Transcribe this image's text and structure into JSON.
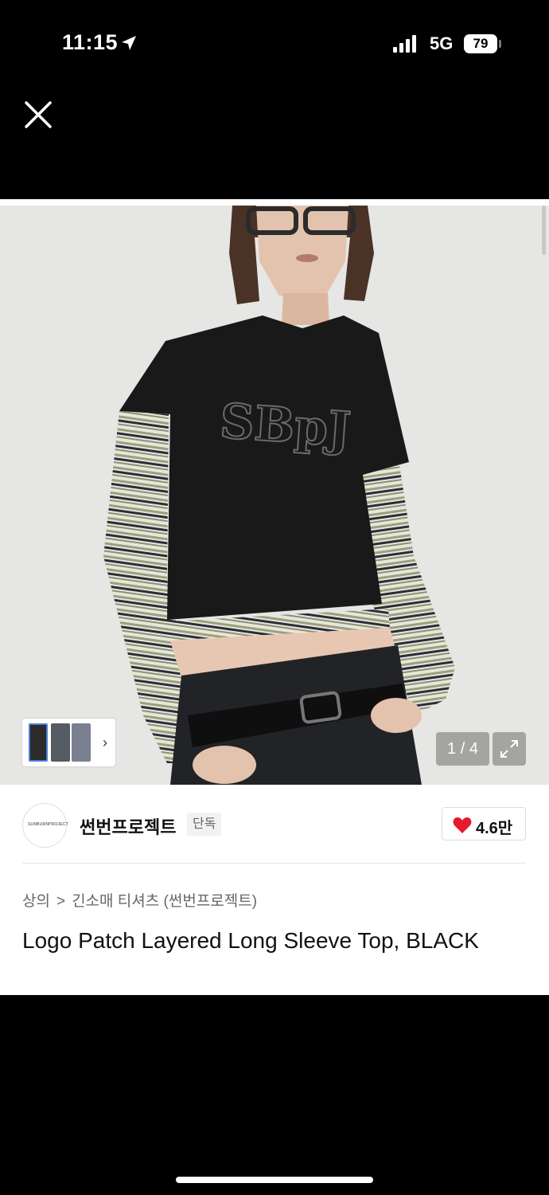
{
  "status_bar": {
    "time": "11:15",
    "network": "5G",
    "battery": "79"
  },
  "gallery": {
    "counter": "1 / 4",
    "thumb_chevron": "›"
  },
  "brand": {
    "logo_text": "SUNBURNPROJECT",
    "name": "썬번프로젝트",
    "badge": "단독",
    "likes": "4.6만"
  },
  "breadcrumb": {
    "category": "상의",
    "separator": ">",
    "subcategory": "긴소매 티셔츠 (썬번프로젝트)"
  },
  "product": {
    "title": "Logo Patch Layered Long Sleeve Top, BLACK"
  },
  "icons": {
    "close": "close-icon",
    "location": "location-arrow-icon",
    "signal": "signal-icon",
    "expand": "expand-icon",
    "heart": "heart-icon"
  },
  "colors": {
    "heart": "#e8192c",
    "background": "#000000",
    "photo_backdrop": "#e6e6e4"
  }
}
